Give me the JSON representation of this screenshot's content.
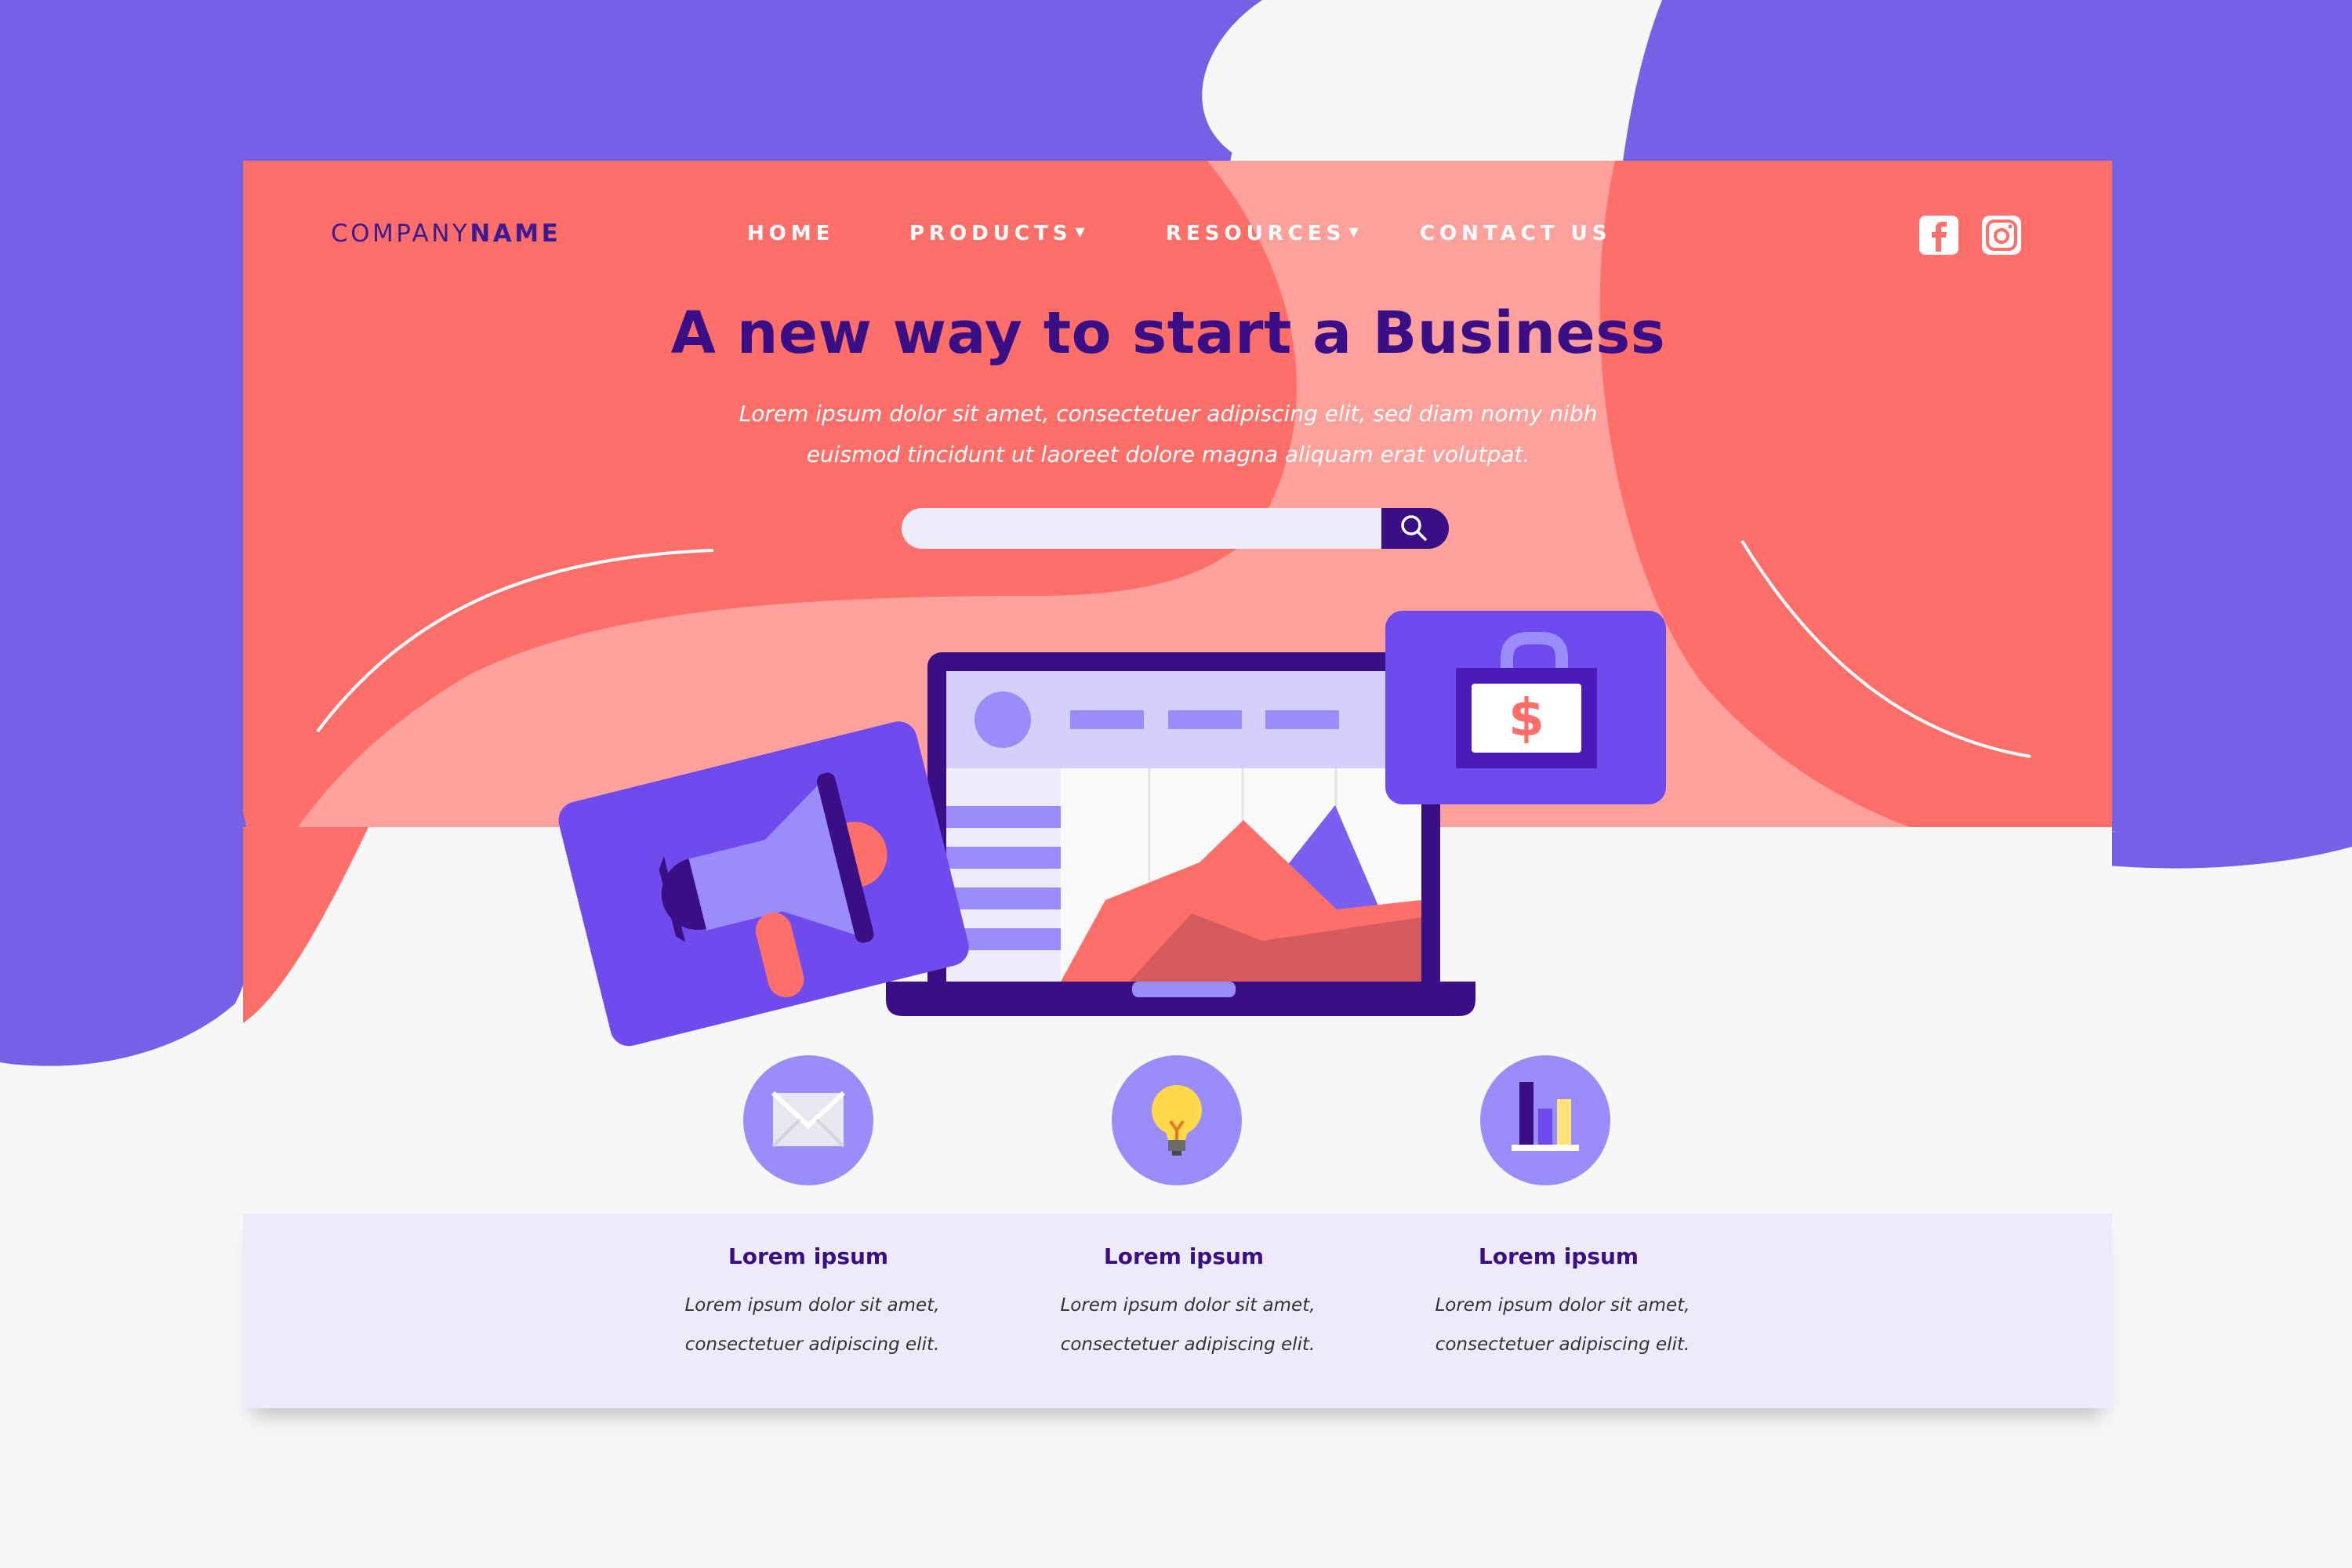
{
  "brand": {
    "logo_light": "COMPANY",
    "logo_bold": "NAME"
  },
  "nav": {
    "items": [
      {
        "label": "HOME",
        "dropdown": false
      },
      {
        "label": "PRODUCTS",
        "dropdown": true
      },
      {
        "label": "RESOURCES",
        "dropdown": true
      },
      {
        "label": "CONTACT US",
        "dropdown": false
      }
    ],
    "social": [
      "facebook-icon",
      "instagram-icon"
    ]
  },
  "hero": {
    "title": "A new way to start a Business",
    "subtitle_line1": "Lorem ipsum dolor sit amet, consectetuer adipiscing elit, sed diam nomy nibh",
    "subtitle_line2": "euismod tincidunt ut laoreet dolore magna aliquam erat volutpat.",
    "search": {
      "placeholder": "",
      "value": "",
      "icon": "search-icon"
    },
    "illustration": {
      "icons": [
        "megaphone-icon",
        "laptop-chart-icon",
        "briefcase-dollar-icon"
      ],
      "currency_symbol": "$"
    }
  },
  "features": [
    {
      "icon": "envelope-icon",
      "title": "Lorem ipsum",
      "line1": "Lorem ipsum dolor sit amet,",
      "line2": "consectetuer adipiscing elit."
    },
    {
      "icon": "lightbulb-icon",
      "title": "Lorem ipsum",
      "line1": "Lorem ipsum dolor sit amet,",
      "line2": "consectetuer adipiscing elit."
    },
    {
      "icon": "bar-chart-icon",
      "title": "Lorem ipsum",
      "line1": "Lorem ipsum dolor sit amet,",
      "line2": "consectetuer adipiscing elit."
    }
  ],
  "colors": {
    "purple": "#7661e6",
    "coral": "#fe6f6a",
    "light_coral": "#fea09b",
    "navy": "#3a0f86",
    "lavender": "#9b8cfb",
    "band": "#edebfb"
  }
}
